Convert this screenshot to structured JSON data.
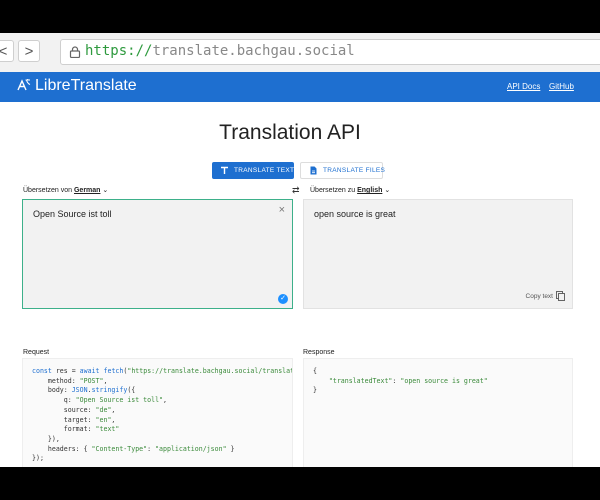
{
  "browser": {
    "back_label": "<",
    "forward_label": ">",
    "url_scheme": "https://",
    "url_host": "translate.bachgau.social"
  },
  "header": {
    "brand": "LibreTranslate",
    "links": [
      "API Docs",
      "GitHub"
    ]
  },
  "main": {
    "title": "Translation API",
    "tabs": [
      {
        "label": "TRANSLATE TEXT",
        "active": true
      },
      {
        "label": "TRANSLATE FILES",
        "active": false
      }
    ],
    "source": {
      "label_prefix": "Übersetzen von",
      "language": "German",
      "text": "Open Source ist toll",
      "clear_symbol": "×"
    },
    "swap_symbol": "⇄",
    "target": {
      "label_prefix": "Übersetzen zu",
      "language": "English",
      "text": "open source is great",
      "copy_label": "Copy text"
    }
  },
  "request": {
    "label": "Request"
  },
  "response": {
    "label": "Response"
  },
  "colors": {
    "brand": "#1e6fd0",
    "source_border": "#3db08a",
    "url_scheme": "#2e9a3e"
  }
}
